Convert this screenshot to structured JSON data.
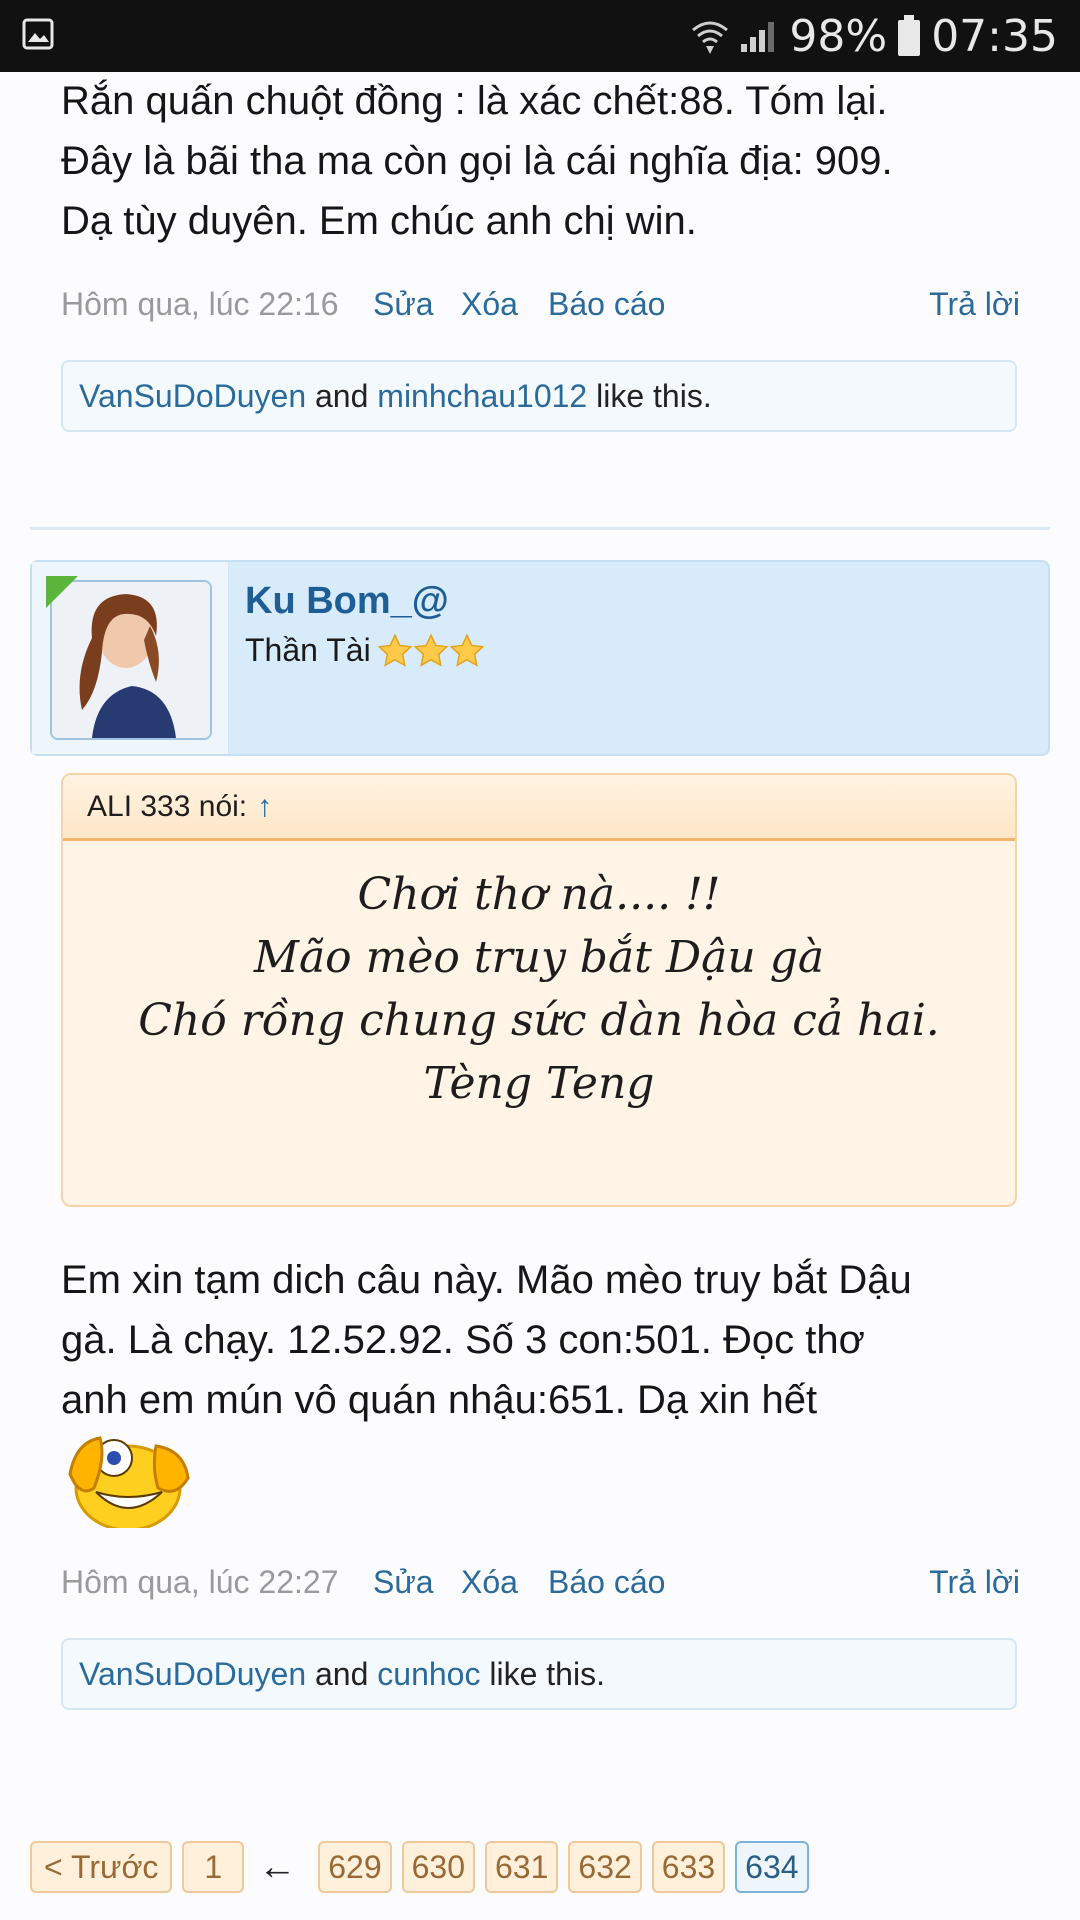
{
  "status_bar": {
    "gallery_icon": "image-icon",
    "wifi_icon": "wifi-icon",
    "signal_icon": "signal-icon",
    "battery_percent": "98%",
    "battery_icon": "battery-icon",
    "time": "07:35"
  },
  "post1": {
    "text_lines": [
      "Rắn quấn chuột đồng : là xác chết:88. Tóm lại.",
      "Đây là bãi tha ma còn gọi là cái nghĩa địa: 909.",
      "Dạ tùy duyên. Em chúc anh chị win."
    ],
    "timestamp": "Hôm qua, lúc 22:16",
    "actions": {
      "edit": "Sửa",
      "delete": "Xóa",
      "report": "Báo cáo",
      "reply": "Trả lời"
    },
    "likes": {
      "user1": "VanSuDoDuyen",
      "and": "and",
      "user2": "minhchau1012",
      "suffix": "like this."
    }
  },
  "post2": {
    "author": {
      "name": "Ku Bom_@",
      "title": "Thần Tài",
      "stars": 3
    },
    "quote": {
      "author_label": "ALI 333 nói:",
      "arrow": "↑",
      "lines": [
        "Chơi thơ nà.... !!",
        "Mão mèo truy bắt Dậu gà",
        "Chó rồng chung sức dàn hòa cả hai.",
        "Tèng Teng"
      ]
    },
    "text_lines": [
      "Em xin tạm dich câu này. Mão mèo truy bắt Dậu",
      "gà. Là chạy. 12.52.92. Số 3 con:501. Đọc thơ",
      "anh em mún vô quán nhậu:651. Dạ xin hết"
    ],
    "emoji_icon": "laughing-peek-emoji-icon",
    "timestamp": "Hôm qua, lúc 22:27",
    "actions": {
      "edit": "Sửa",
      "delete": "Xóa",
      "report": "Báo cáo",
      "reply": "Trả lời"
    },
    "likes": {
      "user1": "VanSuDoDuyen",
      "and": "and",
      "user2": "cunhoc",
      "suffix": "like this."
    }
  },
  "pagination": {
    "prev": "< Trước",
    "first": "1",
    "back_arrow": "←",
    "pages": [
      "629",
      "630",
      "631",
      "632",
      "633",
      "634"
    ],
    "current": "634"
  }
}
